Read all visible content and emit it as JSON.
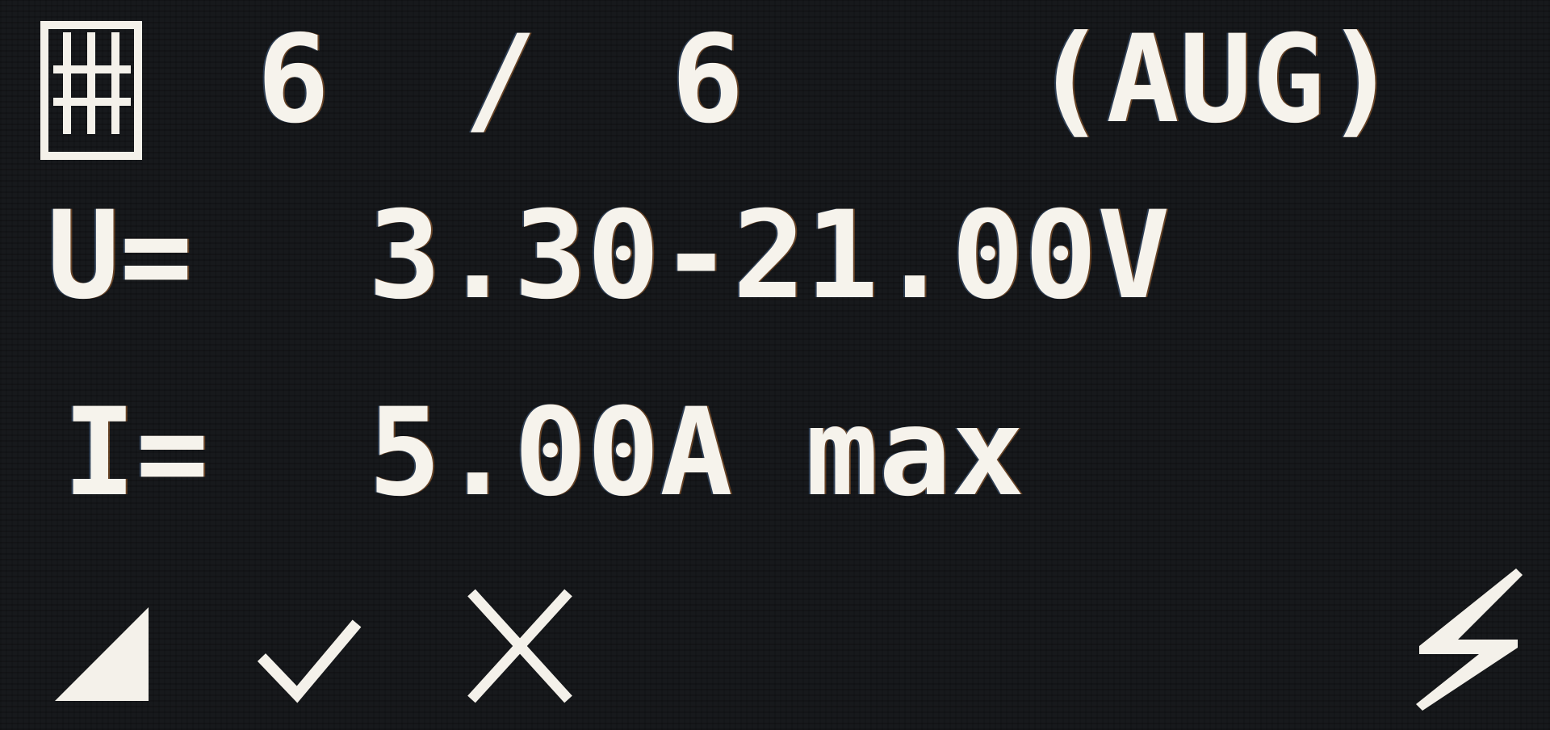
{
  "status": {
    "slot_icon": "grid-memory-icon",
    "slot_count": "6 / 6",
    "slot_month": "(AUG)"
  },
  "voltage": {
    "label": "U=",
    "value": "3.30-21.00V"
  },
  "current": {
    "label": "I=",
    "value": "5.00A max"
  },
  "indicators": {
    "signal": "signal-triangle-icon",
    "check": "check-icon",
    "close": "close-icon",
    "power": "lightning-bolt-icon"
  },
  "colors": {
    "background": "#17191c",
    "text": "#f6f3ec"
  }
}
